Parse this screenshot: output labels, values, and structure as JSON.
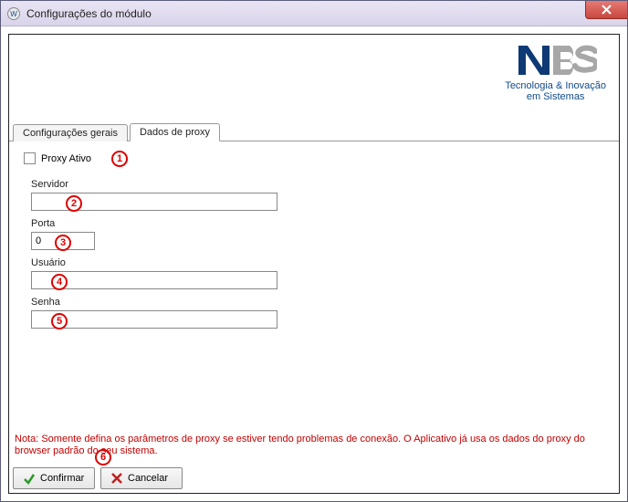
{
  "window": {
    "title": "Configurações do módulo",
    "close_label": "x"
  },
  "logo": {
    "line1": "Tecnologia & Inovação",
    "line2": "em Sistemas"
  },
  "tabs": {
    "general": "Configurações gerais",
    "proxy": "Dados de proxy"
  },
  "proxy": {
    "active_label": "Proxy Ativo",
    "server_label": "Servidor",
    "server_value": "",
    "port_label": "Porta",
    "port_value": "0",
    "user_label": "Usuário",
    "user_value": "",
    "password_label": "Senha",
    "password_value": ""
  },
  "note": "Nota: Somente defina os parâmetros de proxy se estiver tendo problemas de conexão. O Aplicativo já usa os dados do proxy do browser padrão do seu sistema.",
  "buttons": {
    "confirm": "Confirmar",
    "cancel": "Cancelar"
  },
  "annotations": {
    "a1": "1",
    "a2": "2",
    "a3": "3",
    "a4": "4",
    "a5": "5",
    "a6": "6"
  }
}
